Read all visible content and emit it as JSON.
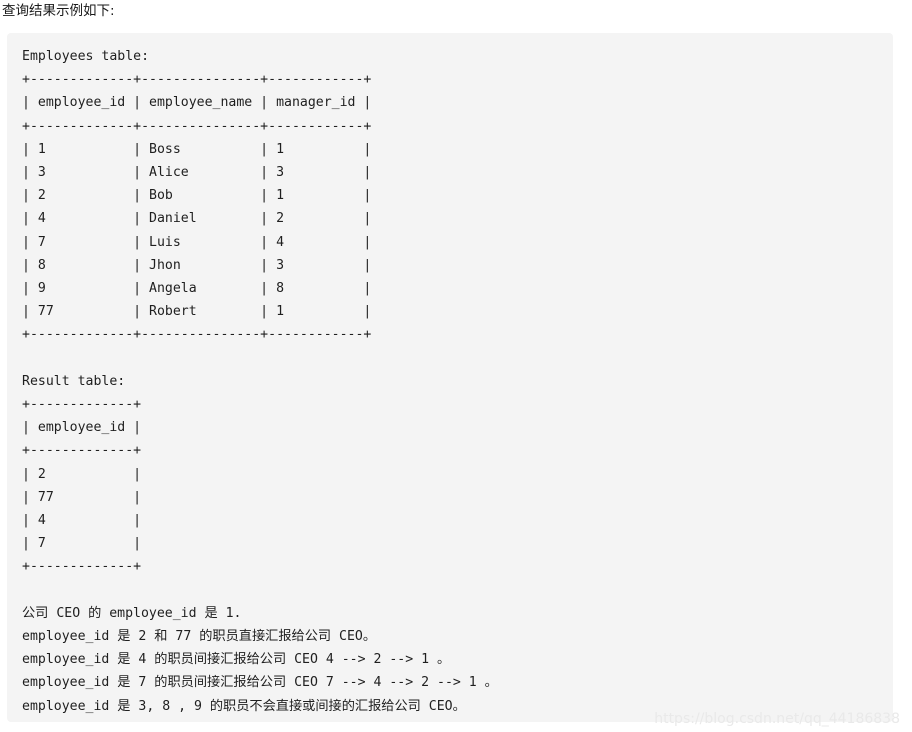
{
  "page": {
    "intro_text": "查询结果示例如下:",
    "background_color": "#ffffff",
    "code_block_background": "#f4f4f4",
    "text_color": "#1f1f1f"
  },
  "code_block": {
    "employees_table": {
      "caption": "Employees table:",
      "border_line": "+-------------+---------------+------------+",
      "header_line": "| employee_id | employee_name | manager_id |",
      "columns": [
        "employee_id",
        "employee_name",
        "manager_id"
      ],
      "rows": [
        {
          "employee_id": "1",
          "employee_name": "Boss",
          "manager_id": "1",
          "line": "| 1           | Boss          | 1          |"
        },
        {
          "employee_id": "3",
          "employee_name": "Alice",
          "manager_id": "3",
          "line": "| 3           | Alice         | 3          |"
        },
        {
          "employee_id": "2",
          "employee_name": "Bob",
          "manager_id": "1",
          "line": "| 2           | Bob           | 1          |"
        },
        {
          "employee_id": "4",
          "employee_name": "Daniel",
          "manager_id": "2",
          "line": "| 4           | Daniel        | 2          |"
        },
        {
          "employee_id": "7",
          "employee_name": "Luis",
          "manager_id": "4",
          "line": "| 7           | Luis          | 4          |"
        },
        {
          "employee_id": "8",
          "employee_name": "Jhon",
          "manager_id": "3",
          "line": "| 8           | Jhon          | 3          |"
        },
        {
          "employee_id": "9",
          "employee_name": "Angela",
          "manager_id": "8",
          "line": "| 9           | Angela        | 8          |"
        },
        {
          "employee_id": "77",
          "employee_name": "Robert",
          "manager_id": "1",
          "line": "| 77          | Robert        | 1          |"
        }
      ]
    },
    "result_table": {
      "caption": "Result table:",
      "border_line": "+-------------+",
      "header_line": "| employee_id |",
      "columns": [
        "employee_id"
      ],
      "rows": [
        {
          "employee_id": "2",
          "line": "| 2           |"
        },
        {
          "employee_id": "77",
          "line": "| 77          |"
        },
        {
          "employee_id": "4",
          "line": "| 4           |"
        },
        {
          "employee_id": "7",
          "line": "| 7           |"
        }
      ]
    },
    "explanation": {
      "lines": [
        "公司 CEO 的 employee_id 是 1.",
        "employee_id 是 2 和 77 的职员直接汇报给公司 CEO。",
        "employee_id 是 4 的职员间接汇报给公司 CEO 4 --> 2 --> 1 。",
        "employee_id 是 7 的职员间接汇报给公司 CEO 7 --> 4 --> 2 --> 1 。",
        "employee_id 是 3, 8 , 9 的职员不会直接或间接的汇报给公司 CEO。"
      ]
    }
  },
  "watermark": {
    "text": "https://blog.csdn.net/qq_44186838"
  }
}
